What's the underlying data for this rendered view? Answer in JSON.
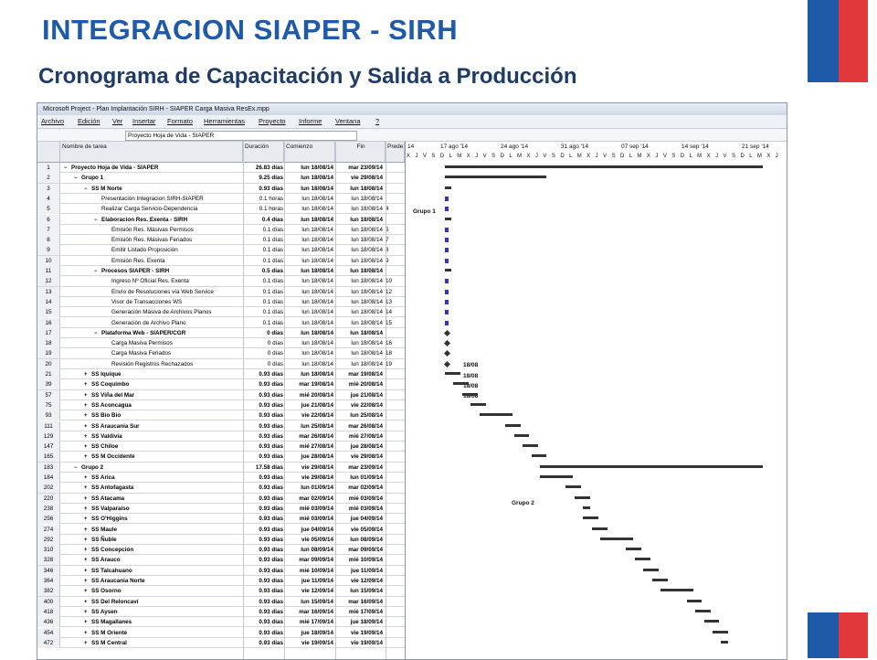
{
  "slide": {
    "title": "INTEGRACION SIAPER - SIRH",
    "subtitle": "Cronograma de Capacitación y Salida a Producción"
  },
  "colors": {
    "flag_blue": "#1e5aa8",
    "flag_red": "#e0383b",
    "title": "#1e5aa8",
    "subtitle": "#1f3b68"
  },
  "window": {
    "title": "Microsoft Project - Plan Implantación SIRH - SIAPER Carga Masiva ResEx.mpp",
    "menu": [
      "Archivo",
      "Edición",
      "Ver",
      "Insertar",
      "Formato",
      "Herramientas",
      "Proyecto",
      "Informe",
      "Ventana",
      "?"
    ],
    "entry_value": "Proyecto Hoja de Vida - SIAPER"
  },
  "columns": {
    "name": "Nombre de tarea",
    "duration": "Duración",
    "start": "Comienzo",
    "end": "Fin",
    "pred": "Prede"
  },
  "timescale": {
    "weeks": [
      "14",
      "17 ago '14",
      "24 ago '14",
      "31 ago '14",
      "07 sep '14",
      "14 sep '14",
      "21 sep '14"
    ],
    "days": "X J V S D L M X J V S D L M X J V S D L M X J V S D L M X J V S D L M X J V S D L M X J"
  },
  "gantt_labels": {
    "grupo1": "Grupo 1",
    "grupo2": "Grupo 2",
    "m17": "18/08",
    "m18": "18/08",
    "m19": "18/08",
    "m20": "18/08"
  },
  "rows": [
    {
      "id": "1",
      "name": "Proyecto Hoja de Vida - SIAPER",
      "dur": "26.83 días",
      "start": "lun 18/08/14",
      "end": "mar 23/09/14",
      "pred": "",
      "bold": true,
      "lvl": 0,
      "mk": "−"
    },
    {
      "id": "2",
      "name": "Grupo 1",
      "dur": "9.25 días",
      "start": "lun 18/08/14",
      "end": "vie 29/08/14",
      "pred": "",
      "bold": true,
      "lvl": 1,
      "mk": "−"
    },
    {
      "id": "3",
      "name": "SS M Norte",
      "dur": "0.93 días",
      "start": "lun 18/08/14",
      "end": "lun 18/08/14",
      "pred": "",
      "bold": true,
      "lvl": 2,
      "mk": "−"
    },
    {
      "id": "4",
      "name": "Presentación Integracion SIRH-SIAPER",
      "dur": "0.1 horas",
      "start": "lun 18/08/14",
      "end": "lun 18/08/14",
      "pred": "",
      "bold": false,
      "lvl": 3,
      "mk": ""
    },
    {
      "id": "5",
      "name": "Realizar Carga Servicio-Dependencia",
      "dur": "0.1 horas",
      "start": "lun 18/08/14",
      "end": "lun 18/08/14",
      "pred": "4",
      "bold": false,
      "lvl": 3,
      "mk": ""
    },
    {
      "id": "6",
      "name": "Elaboracion Res. Exenta - SIRH",
      "dur": "0.4 días",
      "start": "lun 18/08/14",
      "end": "lun 18/08/14",
      "pred": "",
      "bold": true,
      "lvl": 3,
      "mk": "−"
    },
    {
      "id": "7",
      "name": "Emisión Res. Másivas Permisos",
      "dur": "0.1 días",
      "start": "lun 18/08/14",
      "end": "lun 18/08/14",
      "pred": "5",
      "bold": false,
      "lvl": 4,
      "mk": ""
    },
    {
      "id": "8",
      "name": "Emisión Res. Másivas Feriados",
      "dur": "0.1 días",
      "start": "lun 18/08/14",
      "end": "lun 18/08/14",
      "pred": "7",
      "bold": false,
      "lvl": 4,
      "mk": ""
    },
    {
      "id": "9",
      "name": "Emitir Listado Proposición",
      "dur": "0.1 días",
      "start": "lun 18/08/14",
      "end": "lun 18/08/14",
      "pred": "8",
      "bold": false,
      "lvl": 4,
      "mk": ""
    },
    {
      "id": "10",
      "name": "Emisión Res. Exenta",
      "dur": "0.1 días",
      "start": "lun 18/08/14",
      "end": "lun 18/08/14",
      "pred": "9",
      "bold": false,
      "lvl": 4,
      "mk": ""
    },
    {
      "id": "11",
      "name": "Procesos SIAPER - SIRH",
      "dur": "0.5 días",
      "start": "lun 18/08/14",
      "end": "lun 18/08/14",
      "pred": "",
      "bold": true,
      "lvl": 3,
      "mk": "−"
    },
    {
      "id": "12",
      "name": "Ingreso Nº Oficial Res. Exenta",
      "dur": "0.1 días",
      "start": "lun 18/08/14",
      "end": "lun 18/08/14",
      "pred": "10",
      "bold": false,
      "lvl": 4,
      "mk": ""
    },
    {
      "id": "13",
      "name": "Envío de Resoluciones vía Web Service",
      "dur": "0.1 días",
      "start": "lun 18/08/14",
      "end": "lun 18/08/14",
      "pred": "12",
      "bold": false,
      "lvl": 4,
      "mk": ""
    },
    {
      "id": "14",
      "name": "Visor de Transacciones WS",
      "dur": "0.1 días",
      "start": "lun 18/08/14",
      "end": "lun 18/08/14",
      "pred": "13",
      "bold": false,
      "lvl": 4,
      "mk": ""
    },
    {
      "id": "15",
      "name": "Generación Másiva de Archivos Planos",
      "dur": "0.1 días",
      "start": "lun 18/08/14",
      "end": "lun 18/08/14",
      "pred": "14",
      "bold": false,
      "lvl": 4,
      "mk": ""
    },
    {
      "id": "16",
      "name": "Generación de Archivo Plano",
      "dur": "0.1 días",
      "start": "lun 18/08/14",
      "end": "lun 18/08/14",
      "pred": "15",
      "bold": false,
      "lvl": 4,
      "mk": ""
    },
    {
      "id": "17",
      "name": "Plataforma Web - SIAPER/CGR",
      "dur": "0 días",
      "start": "lun 18/08/14",
      "end": "lun 18/08/14",
      "pred": "",
      "bold": true,
      "lvl": 3,
      "mk": "−"
    },
    {
      "id": "18",
      "name": "Carga Masiva Permisos",
      "dur": "0 días",
      "start": "lun 18/08/14",
      "end": "lun 18/08/14",
      "pred": "16",
      "bold": false,
      "lvl": 4,
      "mk": ""
    },
    {
      "id": "19",
      "name": "Carga Masiva Feriados",
      "dur": "0 días",
      "start": "lun 18/08/14",
      "end": "lun 18/08/14",
      "pred": "18",
      "bold": false,
      "lvl": 4,
      "mk": ""
    },
    {
      "id": "20",
      "name": "Revisión Registros Rechazados",
      "dur": "0 días",
      "start": "lun 18/08/14",
      "end": "lun 18/08/14",
      "pred": "19",
      "bold": false,
      "lvl": 4,
      "mk": ""
    },
    {
      "id": "21",
      "name": "SS Iquique",
      "dur": "0.93 días",
      "start": "lun 18/08/14",
      "end": "mar 19/08/14",
      "pred": "",
      "bold": true,
      "lvl": 2,
      "mk": "+"
    },
    {
      "id": "39",
      "name": "SS Coquimbo",
      "dur": "0.93 días",
      "start": "mar 19/08/14",
      "end": "mié 20/08/14",
      "pred": "",
      "bold": true,
      "lvl": 2,
      "mk": "+"
    },
    {
      "id": "57",
      "name": "SS Viña del Mar",
      "dur": "0.93 días",
      "start": "mié 20/08/14",
      "end": "jue 21/08/14",
      "pred": "",
      "bold": true,
      "lvl": 2,
      "mk": "+"
    },
    {
      "id": "75",
      "name": "SS Aconcagua",
      "dur": "0.93 días",
      "start": "jue 21/08/14",
      "end": "vie 22/08/14",
      "pred": "",
      "bold": true,
      "lvl": 2,
      "mk": "+"
    },
    {
      "id": "93",
      "name": "SS Bio Bio",
      "dur": "0.93 días",
      "start": "vie 22/08/14",
      "end": "lun 25/08/14",
      "pred": "",
      "bold": true,
      "lvl": 2,
      "mk": "+"
    },
    {
      "id": "111",
      "name": "SS Araucania Sur",
      "dur": "0.93 días",
      "start": "lun 25/08/14",
      "end": "mar 26/08/14",
      "pred": "",
      "bold": true,
      "lvl": 2,
      "mk": "+"
    },
    {
      "id": "129",
      "name": "SS Valdivia",
      "dur": "0.93 días",
      "start": "mar 26/08/14",
      "end": "mié 27/08/14",
      "pred": "",
      "bold": true,
      "lvl": 2,
      "mk": "+"
    },
    {
      "id": "147",
      "name": "SS Chiloe",
      "dur": "0.93 días",
      "start": "mié 27/08/14",
      "end": "jue 28/08/14",
      "pred": "",
      "bold": true,
      "lvl": 2,
      "mk": "+"
    },
    {
      "id": "165",
      "name": "SS M Occidente",
      "dur": "0.93 días",
      "start": "jue 28/08/14",
      "end": "vie 29/08/14",
      "pred": "",
      "bold": true,
      "lvl": 2,
      "mk": "+"
    },
    {
      "id": "183",
      "name": "Grupo 2",
      "dur": "17.58 días",
      "start": "vie 29/08/14",
      "end": "mar 23/09/14",
      "pred": "",
      "bold": true,
      "lvl": 1,
      "mk": "−"
    },
    {
      "id": "184",
      "name": "SS Arica",
      "dur": "0.93 días",
      "start": "vie 29/08/14",
      "end": "lun 01/09/14",
      "pred": "",
      "bold": true,
      "lvl": 2,
      "mk": "+"
    },
    {
      "id": "202",
      "name": "SS Antofagasta",
      "dur": "0.93 días",
      "start": "lun 01/09/14",
      "end": "mar 02/09/14",
      "pred": "",
      "bold": true,
      "lvl": 2,
      "mk": "+"
    },
    {
      "id": "220",
      "name": "SS Atacama",
      "dur": "0.93 días",
      "start": "mar 02/09/14",
      "end": "mié 03/09/14",
      "pred": "",
      "bold": true,
      "lvl": 2,
      "mk": "+"
    },
    {
      "id": "238",
      "name": "SS Valparaiso",
      "dur": "0.93 días",
      "start": "mié 03/09/14",
      "end": "mié 03/09/14",
      "pred": "",
      "bold": true,
      "lvl": 2,
      "mk": "+"
    },
    {
      "id": "256",
      "name": "SS O'Higgins",
      "dur": "0.93 días",
      "start": "mié 03/09/14",
      "end": "jue 04/09/14",
      "pred": "",
      "bold": true,
      "lvl": 2,
      "mk": "+"
    },
    {
      "id": "274",
      "name": "SS Maule",
      "dur": "0.93 días",
      "start": "jue 04/09/14",
      "end": "vie 05/09/14",
      "pred": "",
      "bold": true,
      "lvl": 2,
      "mk": "+"
    },
    {
      "id": "292",
      "name": "SS Ñuble",
      "dur": "0.93 días",
      "start": "vie 05/09/14",
      "end": "lun 08/09/14",
      "pred": "",
      "bold": true,
      "lvl": 2,
      "mk": "+"
    },
    {
      "id": "310",
      "name": "SS Concepción",
      "dur": "0.93 días",
      "start": "lun 08/09/14",
      "end": "mar 09/09/14",
      "pred": "",
      "bold": true,
      "lvl": 2,
      "mk": "+"
    },
    {
      "id": "328",
      "name": "SS Arauco",
      "dur": "0.93 días",
      "start": "mar 09/09/14",
      "end": "mié 10/09/14",
      "pred": "",
      "bold": true,
      "lvl": 2,
      "mk": "+"
    },
    {
      "id": "346",
      "name": "SS Talcahuano",
      "dur": "0.93 días",
      "start": "mié 10/09/14",
      "end": "jue 11/09/14",
      "pred": "",
      "bold": true,
      "lvl": 2,
      "mk": "+"
    },
    {
      "id": "364",
      "name": "SS Araucania Norte",
      "dur": "0.93 días",
      "start": "jue 11/09/14",
      "end": "vie 12/09/14",
      "pred": "",
      "bold": true,
      "lvl": 2,
      "mk": "+"
    },
    {
      "id": "382",
      "name": "SS Osorno",
      "dur": "0.93 días",
      "start": "vie 12/09/14",
      "end": "lun 15/09/14",
      "pred": "",
      "bold": true,
      "lvl": 2,
      "mk": "+"
    },
    {
      "id": "400",
      "name": "SS Del Reloncaví",
      "dur": "0.93 días",
      "start": "lun 15/09/14",
      "end": "mar 16/09/14",
      "pred": "",
      "bold": true,
      "lvl": 2,
      "mk": "+"
    },
    {
      "id": "418",
      "name": "SS Aysen",
      "dur": "0.93 días",
      "start": "mar 16/09/14",
      "end": "mié 17/09/14",
      "pred": "",
      "bold": true,
      "lvl": 2,
      "mk": "+"
    },
    {
      "id": "436",
      "name": "SS Magallanes",
      "dur": "0.93 días",
      "start": "mié 17/09/14",
      "end": "jue 18/09/14",
      "pred": "",
      "bold": true,
      "lvl": 2,
      "mk": "+"
    },
    {
      "id": "454",
      "name": "SS M Oriente",
      "dur": "0.93 días",
      "start": "jue 18/09/14",
      "end": "vie 19/09/14",
      "pred": "",
      "bold": true,
      "lvl": 2,
      "mk": "+"
    },
    {
      "id": "472",
      "name": "SS M Central",
      "dur": "0.93 días",
      "start": "vie 19/09/14",
      "end": "vie 19/09/14",
      "pred": "",
      "bold": true,
      "lvl": 2,
      "mk": "+"
    }
  ]
}
